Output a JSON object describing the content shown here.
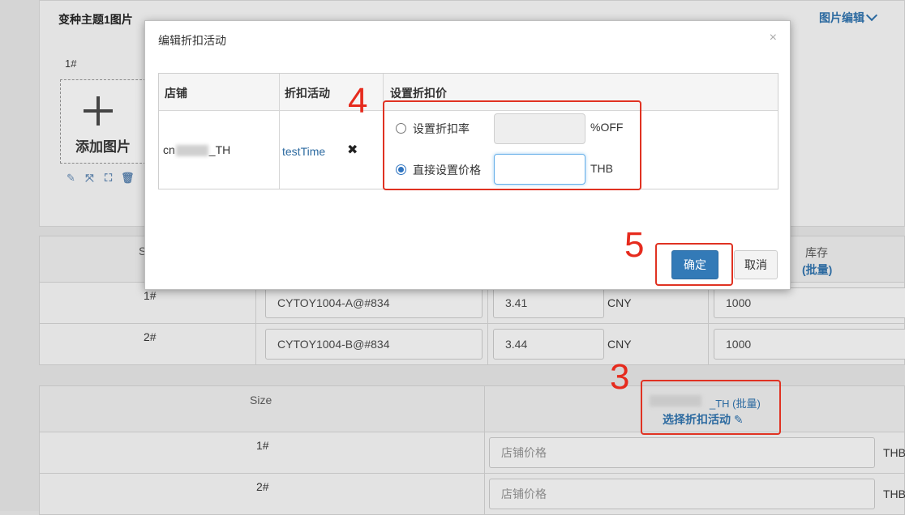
{
  "page": {
    "variant_title": "变种主题1图片",
    "image_edit_label": "图片编辑",
    "slot_label": "1#",
    "add_image_label": "添加图片",
    "tools": [
      "wand-icon",
      "crop-icon",
      "resize-icon",
      "trash-icon"
    ]
  },
  "sku_table": {
    "header_left": "S",
    "stock_header": "库存",
    "stock_batch": "(批量)",
    "rows": [
      {
        "size": "1#",
        "sku": "CYTOY1004-A@#834",
        "price": "3.41",
        "currency": "CNY",
        "stock": "1000"
      },
      {
        "size": "2#",
        "sku": "CYTOY1004-B@#834",
        "price": "3.44",
        "currency": "CNY",
        "stock": "1000"
      }
    ]
  },
  "price_table": {
    "size_header": "Size",
    "shop_suffix": "_TH (批量)",
    "select_activity": "选择折扣活动",
    "rows": [
      {
        "size": "1#",
        "placeholder": "店铺价格",
        "currency": "THB"
      },
      {
        "size": "2#",
        "placeholder": "店铺价格",
        "currency": "THB"
      }
    ]
  },
  "modal": {
    "title": "编辑折扣活动",
    "close": "×",
    "headers": {
      "shop": "店铺",
      "activity": "折扣活动",
      "price": "设置折扣价"
    },
    "shop_prefix": "cn",
    "shop_suffix": "_TH",
    "activity": "testTime",
    "remove": "✖",
    "option_rate_label": "设置折扣率",
    "option_rate_unit": "%OFF",
    "option_price_label": "直接设置价格",
    "option_price_unit": "THB",
    "selected_option": "price",
    "confirm": "确定",
    "cancel": "取消"
  },
  "annotations": [
    "3",
    "4",
    "5"
  ],
  "colors": {
    "accent": "#337ab7",
    "annotation": "#e03222",
    "link": "#2c6aa0"
  }
}
